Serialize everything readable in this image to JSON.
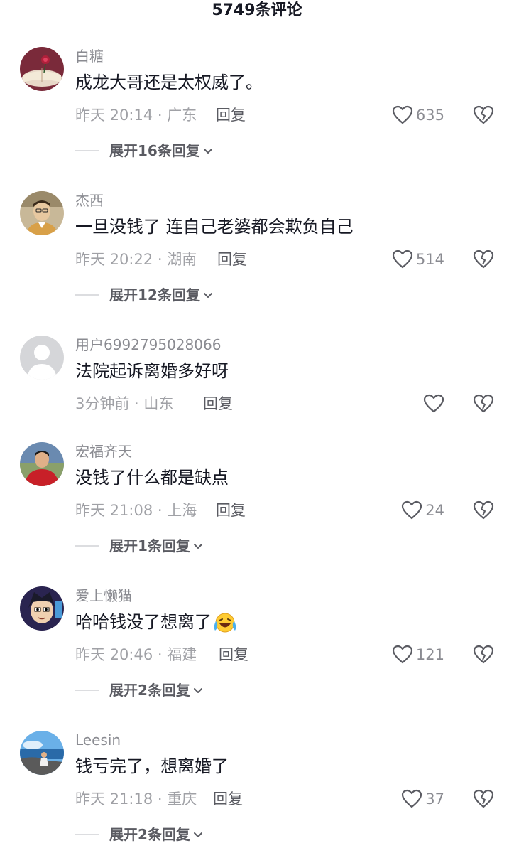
{
  "header": {
    "title": "5749条评论"
  },
  "comments": [
    {
      "username": "白糖",
      "text": "成龙大哥还是太权威了。",
      "meta": "昨天 20:14 · 广东",
      "reply_label": "回复",
      "likes": "635",
      "expand_label": "展开16条回复",
      "avatar": "book-rose-avatar"
    },
    {
      "username": "杰西",
      "text": "一旦没钱了 连自己老婆都会欺负自己",
      "meta": "昨天 20:22 · 湖南",
      "reply_label": "回复",
      "likes": "514",
      "expand_label": "展开12条回复",
      "avatar": "man-portrait-avatar"
    },
    {
      "username": "用户6992795028066",
      "text": "法院起诉离婚多好呀",
      "meta": "3分钟前 · 山东",
      "reply_label": "回复",
      "likes": "",
      "expand_label": "",
      "avatar": "default-user-avatar"
    },
    {
      "username": "宏福齐天",
      "text": "没钱了什么都是缺点",
      "meta": "昨天 21:08 · 上海",
      "reply_label": "回复",
      "likes": "24",
      "expand_label": "展开1条回复",
      "avatar": "man-red-shirt-avatar"
    },
    {
      "username": "爱上懒猫",
      "text": "哈哈钱没了想离了",
      "meta": "昨天 20:46 · 福建",
      "reply_label": "回复",
      "likes": "121",
      "expand_label": "展开2条回复",
      "avatar": "cartoon-face-avatar",
      "emoji": "laugh-cry-emoji"
    },
    {
      "username": "Leesin",
      "text": "钱亏完了，想离婚了",
      "meta": "昨天 21:18 · 重庆",
      "reply_label": "回复",
      "likes": "37",
      "expand_label": "展开2条回复",
      "avatar": "seaside-person-avatar"
    }
  ],
  "colors": {
    "text_primary": "#161823",
    "text_secondary": "#8a8b91",
    "icon_stroke": "#5a5b62"
  }
}
